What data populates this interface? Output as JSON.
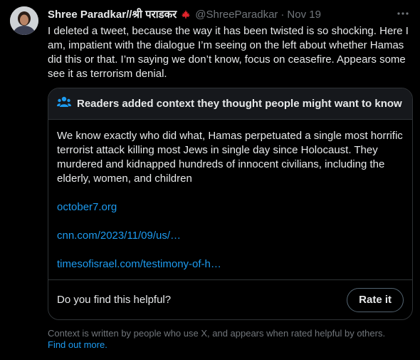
{
  "tweet": {
    "author_name": "Shree Paradkar//श्री पराडकर",
    "handle": "@ShreeParadkar",
    "separator": "·",
    "time": "Nov 19",
    "text": "I deleted a tweet, because the way it has been twisted is so shocking. Here I am, impatient with the dialogue I’m seeing on the left about whether Hamas did this or that. I’m saying we don’t know, focus on ceasefire. Appears some see it as terrorism denial."
  },
  "community_note": {
    "title": "Readers added context they thought people might want to know",
    "body": "We know exactly who did what, Hamas perpetuated a single most horrific terrorist attack killing most Jews in single day since Holocaust. They murdered and kidnapped hundreds of innocent civilians, including the elderly, women, and children",
    "links": [
      "october7.org",
      "cnn.com/2023/11/09/us/…",
      "timesofisrael.com/testimony-of-h…"
    ],
    "helpful_question": "Do you find this helpful?",
    "rate_label": "Rate it"
  },
  "disclaimer": {
    "text": "Context is written by people who use X, and appears when rated helpful by others.",
    "link": "Find out more."
  },
  "icons": {
    "flag": "canada-flag-icon",
    "more": "more-options-icon",
    "note": "people-icon"
  },
  "colors": {
    "background": "#000000",
    "text": "#e7e9ea",
    "muted": "#71767b",
    "link": "#1d9bf0",
    "note_accent": "#1d9bf0",
    "flag_red": "#e0242b"
  }
}
